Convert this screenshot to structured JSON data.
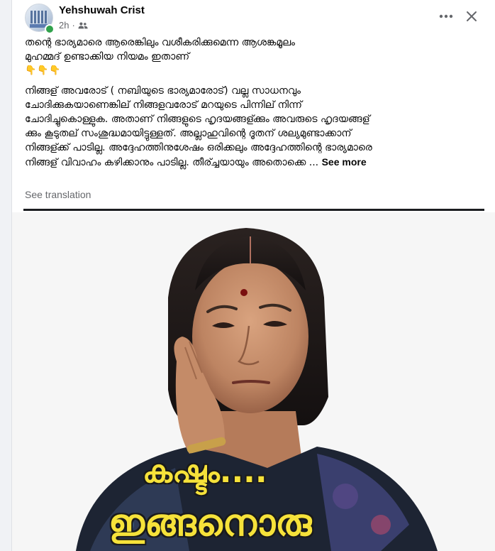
{
  "post": {
    "author": "Yehshuwah Crist",
    "timestamp": "2h",
    "audience_icon": "friends-icon",
    "title_lines": [
      "തന്റെ ഭാര്യമാരെ ആരെങ്കിലും വശീകരിക്കുമെന്ന ആശങ്കമൂലം",
      "മുഹമ്മദ് ഉണ്ടാക്കിയ നിയമം ഇതാണ്"
    ],
    "emojis": "👇👇👇",
    "body_lines": [
      "നിങ്ങള് അവരോട് ( നബിയുടെ ഭാര്യമാരോട്) വല്ല സാധനവും",
      "ചോദിക്കുകയാണെങ്കില് നിങ്ങളവരോട് മറയുടെ പിന്നില് നിന്ന്",
      "ചോദിച്ചുകൊള്ളുക. അതാണ് നിങ്ങളുടെ ഹൃദയങ്ങള്ക്കും അവരുടെ ഹൃദയങ്ങള്",
      "ക്കും കൂടുതല് സംശുദ്ധമായിട്ടുള്ളത്. അല്ലാഹുവിന്റെ ദൂതന് ശല്യമുണ്ടാക്കാന്",
      "നിങ്ങള്ക്ക് പാടില്ല. അദ്ദേഹത്തിനുശേഷം ഒരിക്കലും അദ്ദേഹത്തിന്റെ ഭാര്യമാരെ",
      "നിങ്ങള് വിവാഹം കഴിക്കാനും പാടില്ല. തീര്ച്ചയായും അതൊക്കെ ..."
    ],
    "see_more": "See more",
    "see_translation": "See translation",
    "image_caption": [
      "കഷ്ടം....",
      "ഇങ്ങനൊരു"
    ]
  },
  "colors": {
    "caption_fill": "#f6e23a",
    "online": "#31a24c",
    "secondary_text": "#65676b"
  }
}
